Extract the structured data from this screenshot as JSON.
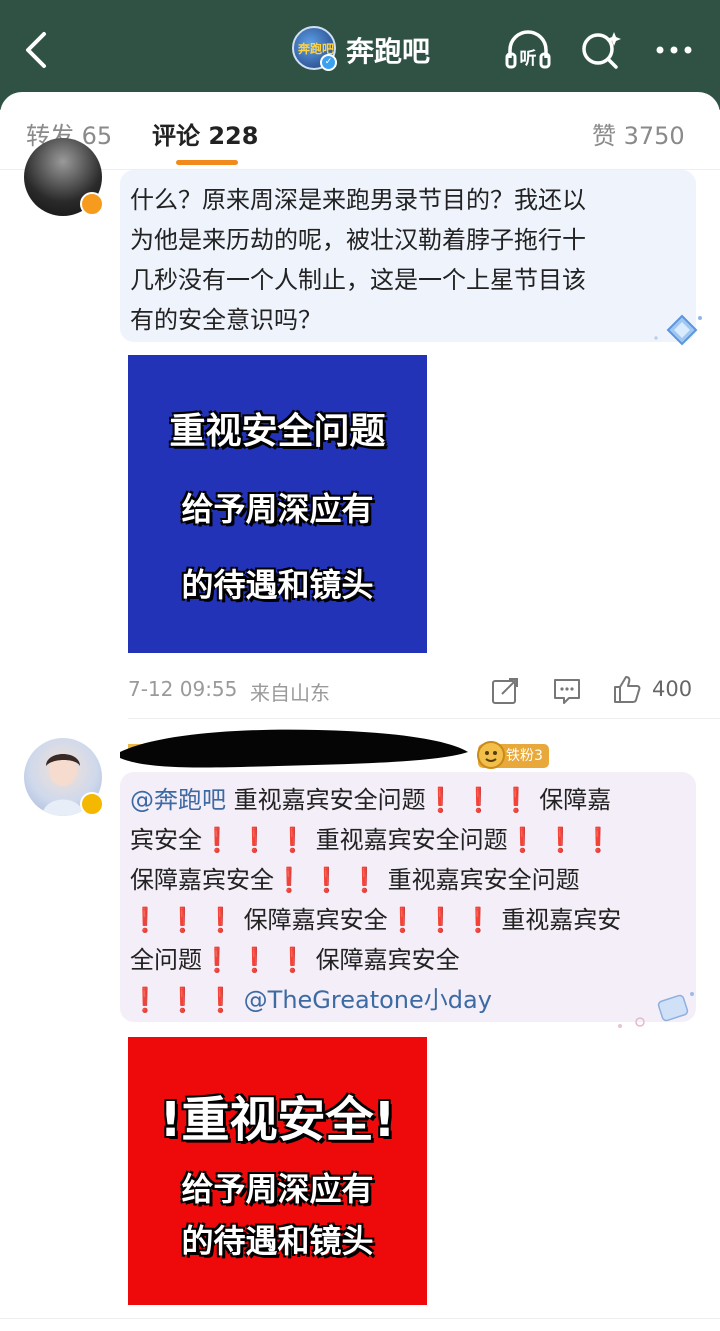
{
  "header": {
    "account_name": "奔跑吧",
    "account_logo_text": "奔跑吧",
    "icons": [
      "back-icon",
      "listen-icon",
      "search-icon",
      "more-icon"
    ],
    "listen_label": "听"
  },
  "tabs": {
    "repost": "转发 65",
    "comments": "评论 228",
    "likes": "赞 3750"
  },
  "comments": [
    {
      "text": "什么？原来周深是来跑男录节目的？我还以为他是来历劫的呢，被壮汉勒着脖子拖行十几秒没有一个人制止，这是一个上星节目该有的安全意识吗？",
      "text_lines": [
        "什么？原来周深是来跑男录节目的？我还以",
        "为他是来历劫的呢，被壮汉勒着脖子拖行十",
        "几秒没有一个人制止，这是一个上星节目该",
        "有的安全意识吗？"
      ],
      "image_lines": [
        "重视安全问题",
        "给予周深应有",
        "的待遇和镜头"
      ],
      "image_bg": "#2233b8",
      "time": "7-12 09:55",
      "source": "来自山东",
      "likes": "400"
    },
    {
      "fan_badge": "铁粉3",
      "segments": {
        "l1_mention": "@奔跑吧",
        "l1_text": " 重视嘉宾安全问题",
        "l1_tail": "保障嘉",
        "l2_text": "宾安全",
        "l2_text2": "重视嘉宾安全问题",
        "l3_text": "保障嘉宾安全",
        "l3_text2": "重视嘉宾安全问题",
        "l4_text": "保障嘉宾安全",
        "l4_text2": "重视嘉宾安",
        "l5_text": "全问题",
        "l5_text2": "保障嘉宾安全",
        "l6_mention": "@TheGreatone小day",
        "exclaim": "❗❗❗"
      },
      "image_lines": [
        "!重视安全!",
        "给予周深应有",
        "的待遇和镜头"
      ],
      "image_bg": "#ee0a0a"
    }
  ],
  "colors": {
    "header_bg": "#2f5245",
    "accent": "#f28a1b",
    "link": "#3c6aa3"
  }
}
